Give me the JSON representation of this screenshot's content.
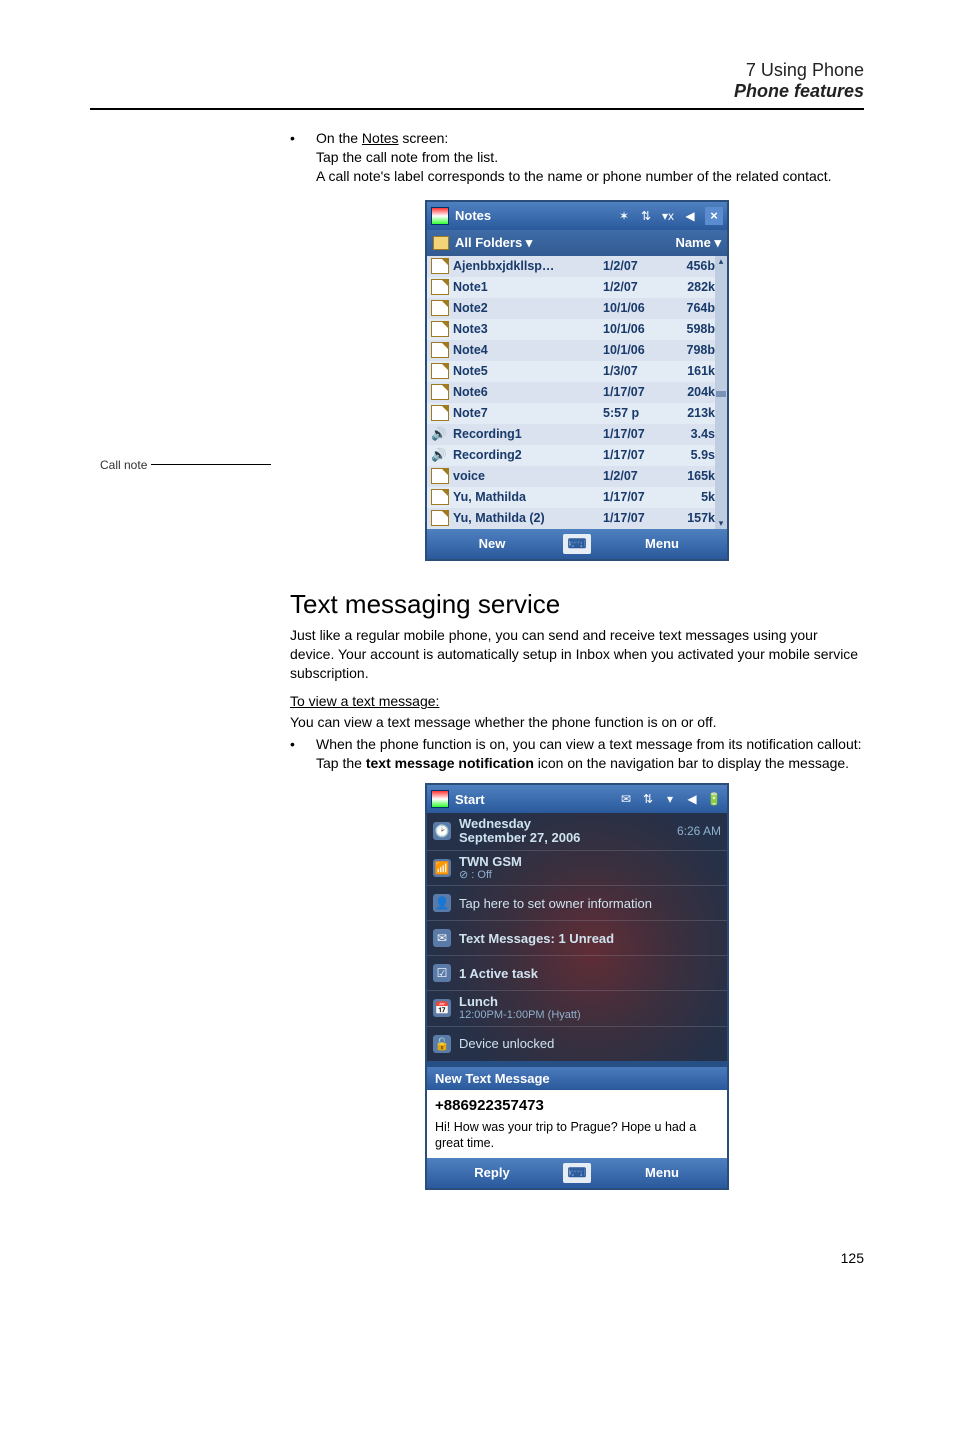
{
  "page": {
    "chapter": "7 Using Phone",
    "section_title": "Phone features",
    "page_number": "125"
  },
  "notes_intro": {
    "bullet_lead": "On the ",
    "notes_word": "Notes",
    "bullet_tail": " screen:",
    "line1": "Tap the call note from the list.",
    "line2": "A call note's label corresponds to the name or phone number of the related contact."
  },
  "callout": {
    "label": "Call note"
  },
  "device1": {
    "title": "Notes",
    "folder_left": "All Folders",
    "folder_right": "Name",
    "softkey_left": "New",
    "kbd_icon": "⌨",
    "softkey_right": "Menu",
    "status_icons": [
      "✶",
      "⇅",
      "▾x",
      "◀",
      "×"
    ],
    "rows": [
      {
        "icon": "folded",
        "name": "Ajenbbxjdkllsp…",
        "date": "1/2/07",
        "size": "456b"
      },
      {
        "icon": "folded",
        "name": "Note1",
        "date": "1/2/07",
        "size": "282k"
      },
      {
        "icon": "folded",
        "name": "Note2",
        "date": "10/1/06",
        "size": "764b"
      },
      {
        "icon": "folded",
        "name": "Note3",
        "date": "10/1/06",
        "size": "598b"
      },
      {
        "icon": "folded",
        "name": "Note4",
        "date": "10/1/06",
        "size": "798b"
      },
      {
        "icon": "folded",
        "name": "Note5",
        "date": "1/3/07",
        "size": "161k"
      },
      {
        "icon": "folded",
        "name": "Note6",
        "date": "1/17/07",
        "size": "204k"
      },
      {
        "icon": "folded",
        "name": "Note7",
        "date": "5:57 p",
        "size": "213k"
      },
      {
        "icon": "rec",
        "name": "Recording1",
        "date": "1/17/07",
        "size": "3.4s"
      },
      {
        "icon": "rec",
        "name": "Recording2",
        "date": "1/17/07",
        "size": "5.9s"
      },
      {
        "icon": "folded",
        "name": "voice",
        "date": "1/2/07",
        "size": "165k"
      },
      {
        "icon": "folded",
        "name": "Yu, Mathilda",
        "date": "1/17/07",
        "size": "5k"
      },
      {
        "icon": "folded",
        "name": "Yu, Mathilda (2)",
        "date": "1/17/07",
        "size": "157k"
      }
    ]
  },
  "text_messaging": {
    "heading": "Text messaging service",
    "para1": "Just like a regular mobile phone, you can send and receive text messages using your device. Your account is automatically setup in Inbox when you activated your mobile service subscription.",
    "subhead": "To view a text message:",
    "para2": "You can view a text message whether the phone function is on or off.",
    "bullet": "When the phone function is on, you can view a text message from its notification callout:",
    "para3a": "Tap the ",
    "para3_bold": "text message notification",
    "para3b": " icon on the navigation bar to display the message."
  },
  "device2": {
    "title": "Start",
    "status_icons": [
      "✉",
      "⇅",
      "▾",
      "◀",
      "🔋"
    ],
    "date_day": "Wednesday",
    "date_full": "September 27, 2006",
    "clock": "6:26 AM",
    "carrier": "TWN GSM",
    "carrier_sub": "⊘ : Off",
    "owner": "Tap here to set owner information",
    "msgs": "Text Messages: 1 Unread",
    "tasks": "1 Active task",
    "appt_title": "Lunch",
    "appt_time": "12:00PM-1:00PM (Hyatt)",
    "lock": "Device unlocked",
    "notif_head": "New Text Message",
    "notif_from": "+886922357473",
    "notif_body": "Hi! How was your trip to Prague? Hope u had a great time.",
    "soft_left": "Reply",
    "kbd_icon": "⌨",
    "soft_right": "Menu"
  }
}
